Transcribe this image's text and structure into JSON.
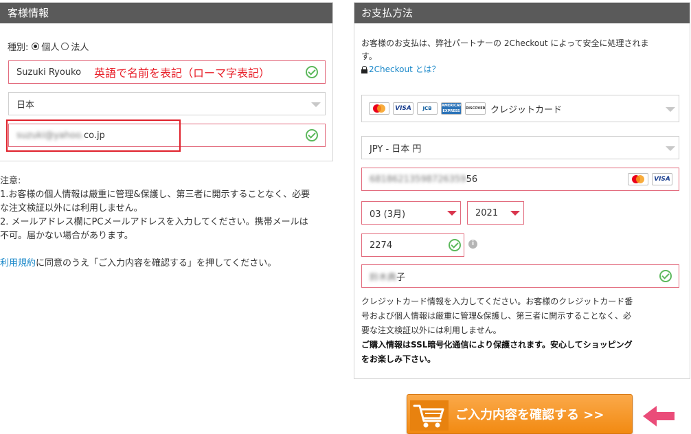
{
  "left_panel": {
    "title": "客様情報",
    "type_label": "種別:",
    "type_options": [
      "個人",
      "法人"
    ],
    "name_value": "Suzuki Ryouko",
    "name_annotation": "英語で名前を表記（ローマ字表記）",
    "country_value": "日本",
    "email_blurred": "suzuki@yahoo.",
    "email_visible": "co.jp"
  },
  "notes": {
    "heading": "注意:",
    "line1a": "1.お客様の個人情報は厳重に管理&保護し、第三者に開示することなく、必要",
    "line1b": "な注文検証以外には利用しません。",
    "line2a": "2. メールアドレス欄にPCメールアドレスを入力してください。携帯メールは",
    "line2b": "不可。届かない場合があります。",
    "terms_link": "利用規約",
    "terms_rest": "に同意のうえ「ご入力内容を確認する」を押してください。"
  },
  "right_panel": {
    "title": "お支払方法",
    "intro_line1": "お客様のお支払は、弊社パートナーの 2Checkout によって安全に処理されま",
    "intro_line2": "す。",
    "checkout_link": "2Checkout とは？",
    "card_logos": [
      "MasterCard",
      "VISA",
      "JCB",
      "AMERICAN EXPRESS",
      "DISCOVER"
    ],
    "method_label": "クレジットカード",
    "currency_value": "JPY - 日本 円",
    "card_number_blurred": "68186213598726359",
    "card_number_visible": "56",
    "month_value": "03 (3月)",
    "year_value": "2021",
    "cvv_value": "2274",
    "holder_blurred": "鈴木典",
    "holder_visible": "子",
    "info_line1": "クレジットカード情報を入力してください。お客様のクレジットカード番",
    "info_line2": "号および個人情報は厳重に管理&保護し、第三者に開示することなく、必",
    "info_line3": "要な注文検証以外には利用しません。",
    "secure_line1": "ご購入情報はSSL暗号化通信により保護されます。安心してショッピング",
    "secure_line2": "をお楽しみ下さい。"
  },
  "confirm_button": {
    "label": "ご入力内容を確認する >>"
  },
  "colors": {
    "header_bg": "#5a5a5a",
    "field_border_red": "#e26a7c",
    "check_green": "#5cb85c",
    "annotation_red": "#e8202a",
    "button_orange": "#f7941d",
    "arrow_pink": "#ea4c79",
    "link_blue": "#1a88c9"
  }
}
